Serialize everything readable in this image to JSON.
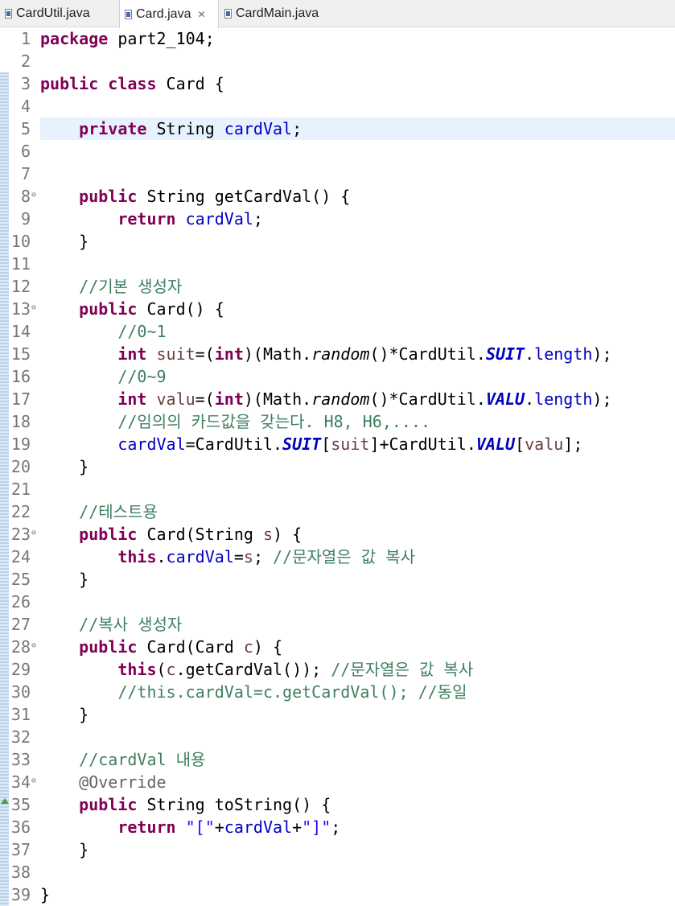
{
  "tabs": [
    {
      "label": "CardUtil.java",
      "active": false
    },
    {
      "label": "Card.java",
      "active": true,
      "close": "✕"
    },
    {
      "label": "CardMain.java",
      "active": false
    }
  ],
  "lines": [
    {
      "n": "1",
      "fold": false,
      "code": [
        [
          "kw",
          "package"
        ],
        [
          "p",
          " part2_104;"
        ]
      ]
    },
    {
      "n": "2",
      "fold": false,
      "code": []
    },
    {
      "n": "3",
      "fold": false,
      "code": [
        [
          "kw",
          "public"
        ],
        [
          "p",
          " "
        ],
        [
          "kw",
          "class"
        ],
        [
          "p",
          " Card {"
        ]
      ]
    },
    {
      "n": "4",
      "fold": false,
      "code": []
    },
    {
      "n": "5",
      "fold": false,
      "code": [
        [
          "p",
          "    "
        ],
        [
          "kw",
          "private"
        ],
        [
          "p",
          " String "
        ],
        [
          "fld",
          "cardVal"
        ],
        [
          "p",
          ";"
        ]
      ]
    },
    {
      "n": "6",
      "fold": false,
      "code": []
    },
    {
      "n": "7",
      "fold": false,
      "code": []
    },
    {
      "n": "8",
      "fold": true,
      "code": [
        [
          "p",
          "    "
        ],
        [
          "kw",
          "public"
        ],
        [
          "p",
          " String getCardVal() {"
        ]
      ]
    },
    {
      "n": "9",
      "fold": false,
      "code": [
        [
          "p",
          "        "
        ],
        [
          "kw",
          "return"
        ],
        [
          "p",
          " "
        ],
        [
          "fld",
          "cardVal"
        ],
        [
          "p",
          ";"
        ]
      ]
    },
    {
      "n": "10",
      "fold": false,
      "code": [
        [
          "p",
          "    }"
        ]
      ]
    },
    {
      "n": "11",
      "fold": false,
      "code": []
    },
    {
      "n": "12",
      "fold": false,
      "code": [
        [
          "p",
          "    "
        ],
        [
          "cm",
          "//기본 생성자"
        ]
      ]
    },
    {
      "n": "13",
      "fold": true,
      "code": [
        [
          "p",
          "    "
        ],
        [
          "kw",
          "public"
        ],
        [
          "p",
          " Card() {"
        ]
      ]
    },
    {
      "n": "14",
      "fold": false,
      "code": [
        [
          "p",
          "        "
        ],
        [
          "cm",
          "//0~1"
        ]
      ]
    },
    {
      "n": "15",
      "fold": false,
      "code": [
        [
          "p",
          "        "
        ],
        [
          "kw",
          "int"
        ],
        [
          "p",
          " "
        ],
        [
          "var",
          "suit"
        ],
        [
          "p",
          "=("
        ],
        [
          "kw",
          "int"
        ],
        [
          "p",
          ")(Math."
        ],
        [
          "meth",
          "random"
        ],
        [
          "p",
          "()*CardUtil."
        ],
        [
          "sfld",
          "SUIT"
        ],
        [
          "p",
          "."
        ],
        [
          "fld",
          "length"
        ],
        [
          "p",
          ");"
        ]
      ]
    },
    {
      "n": "16",
      "fold": false,
      "code": [
        [
          "p",
          "        "
        ],
        [
          "cm",
          "//0~9"
        ]
      ]
    },
    {
      "n": "17",
      "fold": false,
      "code": [
        [
          "p",
          "        "
        ],
        [
          "kw",
          "int"
        ],
        [
          "p",
          " "
        ],
        [
          "var",
          "valu"
        ],
        [
          "p",
          "=("
        ],
        [
          "kw",
          "int"
        ],
        [
          "p",
          ")(Math."
        ],
        [
          "meth",
          "random"
        ],
        [
          "p",
          "()*CardUtil."
        ],
        [
          "sfld",
          "VALU"
        ],
        [
          "p",
          "."
        ],
        [
          "fld",
          "length"
        ],
        [
          "p",
          ");"
        ]
      ]
    },
    {
      "n": "18",
      "fold": false,
      "code": [
        [
          "p",
          "        "
        ],
        [
          "cm",
          "//임의의 카드값을 갖는다. H8, H6,...."
        ]
      ]
    },
    {
      "n": "19",
      "fold": false,
      "code": [
        [
          "p",
          "        "
        ],
        [
          "fld",
          "cardVal"
        ],
        [
          "p",
          "=CardUtil."
        ],
        [
          "sfld",
          "SUIT"
        ],
        [
          "p",
          "["
        ],
        [
          "var",
          "suit"
        ],
        [
          "p",
          "]+CardUtil."
        ],
        [
          "sfld",
          "VALU"
        ],
        [
          "p",
          "["
        ],
        [
          "var",
          "valu"
        ],
        [
          "p",
          "];"
        ]
      ]
    },
    {
      "n": "20",
      "fold": false,
      "code": [
        [
          "p",
          "    }"
        ]
      ]
    },
    {
      "n": "21",
      "fold": false,
      "code": []
    },
    {
      "n": "22",
      "fold": false,
      "code": [
        [
          "p",
          "    "
        ],
        [
          "cm",
          "//테스트용"
        ]
      ]
    },
    {
      "n": "23",
      "fold": true,
      "code": [
        [
          "p",
          "    "
        ],
        [
          "kw",
          "public"
        ],
        [
          "p",
          " Card(String "
        ],
        [
          "var",
          "s"
        ],
        [
          "p",
          ") {"
        ]
      ]
    },
    {
      "n": "24",
      "fold": false,
      "code": [
        [
          "p",
          "        "
        ],
        [
          "kw",
          "this"
        ],
        [
          "p",
          "."
        ],
        [
          "fld",
          "cardVal"
        ],
        [
          "p",
          "="
        ],
        [
          "var",
          "s"
        ],
        [
          "p",
          "; "
        ],
        [
          "cm",
          "//문자열은 값 복사"
        ]
      ]
    },
    {
      "n": "25",
      "fold": false,
      "code": [
        [
          "p",
          "    }"
        ]
      ]
    },
    {
      "n": "26",
      "fold": false,
      "code": []
    },
    {
      "n": "27",
      "fold": false,
      "code": [
        [
          "p",
          "    "
        ],
        [
          "cm",
          "//복사 생성자"
        ]
      ]
    },
    {
      "n": "28",
      "fold": true,
      "code": [
        [
          "p",
          "    "
        ],
        [
          "kw",
          "public"
        ],
        [
          "p",
          " Card(Card "
        ],
        [
          "var",
          "c"
        ],
        [
          "p",
          ") {"
        ]
      ]
    },
    {
      "n": "29",
      "fold": false,
      "code": [
        [
          "p",
          "        "
        ],
        [
          "kw",
          "this"
        ],
        [
          "p",
          "("
        ],
        [
          "var",
          "c"
        ],
        [
          "p",
          ".getCardVal()); "
        ],
        [
          "cm",
          "//문자열은 값 복사"
        ]
      ]
    },
    {
      "n": "30",
      "fold": false,
      "code": [
        [
          "p",
          "        "
        ],
        [
          "cm",
          "//this.cardVal=c.getCardVal(); //동일"
        ]
      ]
    },
    {
      "n": "31",
      "fold": false,
      "code": [
        [
          "p",
          "    }"
        ]
      ]
    },
    {
      "n": "32",
      "fold": false,
      "code": []
    },
    {
      "n": "33",
      "fold": false,
      "code": [
        [
          "p",
          "    "
        ],
        [
          "cm",
          "//cardVal 내용"
        ]
      ]
    },
    {
      "n": "34",
      "fold": true,
      "code": [
        [
          "p",
          "    "
        ],
        [
          "ann",
          "@Override"
        ]
      ]
    },
    {
      "n": "35",
      "fold": false,
      "override": true,
      "code": [
        [
          "p",
          "    "
        ],
        [
          "kw",
          "public"
        ],
        [
          "p",
          " String toString() {"
        ]
      ]
    },
    {
      "n": "36",
      "fold": false,
      "code": [
        [
          "p",
          "        "
        ],
        [
          "kw",
          "return"
        ],
        [
          "p",
          " "
        ],
        [
          "str",
          "\"[\""
        ],
        [
          "p",
          "+"
        ],
        [
          "fld",
          "cardVal"
        ],
        [
          "p",
          "+"
        ],
        [
          "str",
          "\"]\""
        ],
        [
          "p",
          ";"
        ]
      ]
    },
    {
      "n": "37",
      "fold": false,
      "code": [
        [
          "p",
          "    }"
        ]
      ]
    },
    {
      "n": "38",
      "fold": false,
      "code": []
    },
    {
      "n": "39",
      "fold": false,
      "code": [
        [
          "p",
          "}"
        ]
      ]
    }
  ],
  "highlight_line": "5",
  "colors": {
    "keyword": "#7f0055",
    "field": "#0000c0",
    "comment": "#3f7f5f",
    "string": "#2a00ff",
    "annotation": "#646464",
    "local_var": "#6a3e3e",
    "current_line": "#e8f2fe"
  },
  "icons": {
    "file": "java-file-icon",
    "fold": "fold-collapse-icon",
    "override": "override-marker-icon"
  }
}
